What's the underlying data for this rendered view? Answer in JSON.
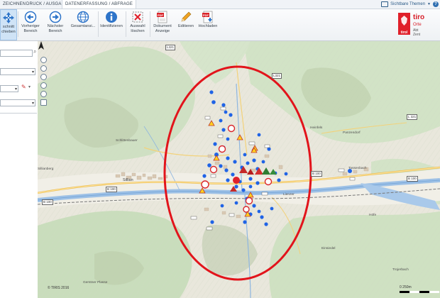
{
  "menu": {
    "tabs": [
      "ZEICHNEN",
      "DRUCK / AUSGABE",
      "DATENERFASSUNG / ABFRAGE"
    ],
    "themes_label": "Sichtbare Themen"
  },
  "toolbar": {
    "tools": [
      {
        "label": "Ausschnitt verschieben",
        "icon": "pan-arrows-icon",
        "selected": true
      },
      {
        "label": "Vorheriger Bereich",
        "icon": "arrow-left-circle-icon"
      },
      {
        "label": "Nächster Bereich",
        "icon": "arrow-right-circle-icon"
      },
      {
        "label": "Gesamtansicht",
        "icon": "globe-icon"
      },
      {
        "label": "Identifizieren",
        "icon": "info-icon"
      },
      {
        "label": "Auswahl löschen",
        "icon": "clear-selection-icon"
      },
      {
        "label": "Dokument Anzeige",
        "icon": "pdf-document-icon"
      },
      {
        "label": "Editieren",
        "icon": "pencil-icon"
      },
      {
        "label": "Hochladen",
        "icon": "pdf-upload-icon"
      }
    ],
    "tool_labels": [
      "schnitt\nchieben",
      "Vorheriger\nBereich",
      "Nächster\nBereich",
      "Gesamtansi...",
      "Identifizieren",
      "Auswahl\nlöschen",
      "Dokument\nAnzeige",
      "Editieren",
      "Hochladen"
    ]
  },
  "brand": {
    "word": "tiro",
    "line2": "Orte",
    "line3": "Abt",
    "line4": "Zent",
    "logo_text": "tirol"
  },
  "map": {
    "places": [
      {
        "name": "Sillianberg",
        "cls": "small"
      },
      {
        "name": "Schlittenbauer",
        "cls": "small"
      },
      {
        "name": "Sillian",
        "cls": ""
      },
      {
        "name": "Lienzer",
        "cls": "small"
      },
      {
        "name": "Tassenbach",
        "cls": "small"
      },
      {
        "name": "Heinfels",
        "cls": "small"
      },
      {
        "name": "Panzendorf",
        "cls": "small"
      },
      {
        "name": "Höfe",
        "cls": "small"
      },
      {
        "name": "Gerstner Plasse",
        "cls": "small"
      },
      {
        "name": "Einsiedel",
        "cls": "small"
      },
      {
        "name": "Trojerbach",
        "cls": "small"
      }
    ],
    "road_labels": [
      "L321",
      "B 100",
      "B 100",
      "L 321",
      "B 100",
      "B 100",
      "L321"
    ],
    "copyright": "© TIRIS 2016",
    "scale_label": "0 250m",
    "annotation": "red-ellipse-highlight"
  },
  "colors": {
    "highlight": "#e2141b",
    "river": "#9ec1e6",
    "marker_blue": "#1f63e6",
    "brand_red": "#e0202a"
  }
}
